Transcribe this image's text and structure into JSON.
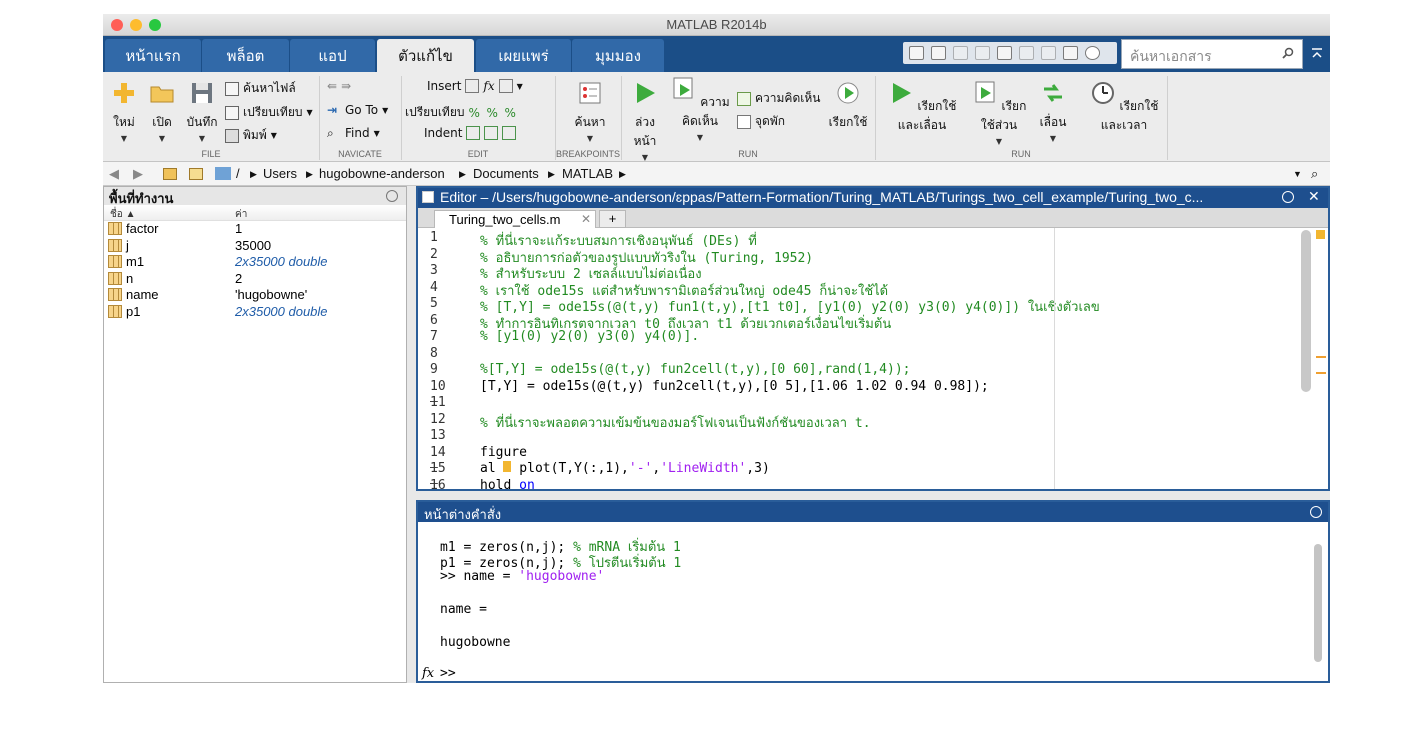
{
  "window": {
    "title": "MATLAB R2014b"
  },
  "tabs": [
    {
      "label": "หน้าแรก"
    },
    {
      "label": "พล็อต"
    },
    {
      "label": "แอป"
    },
    {
      "label": "ตัวแก้ไข",
      "active": true
    },
    {
      "label": "เผยแพร่"
    },
    {
      "label": "มุมมอง"
    }
  ],
  "search": {
    "placeholder": "ค้นหาเอกสาร"
  },
  "ribbon": {
    "file": {
      "new": "ใหม่",
      "open": "เปิด",
      "save": "บันทึก",
      "find_files": "ค้นหาไฟล์",
      "compare": "เปรียบเทียบ",
      "print": "พิมพ์",
      "section": "FILE"
    },
    "navigate": {
      "goto": "Go To",
      "find": "Find",
      "section": "NAVICATE"
    },
    "edit": {
      "insert": "Insert",
      "compare": "เปรียบเทียบ",
      "indent": "Indent",
      "section": "EDIT"
    },
    "breakpoints": {
      "search": "ค้นหา",
      "section": "BREAKPOINTS"
    },
    "run1": {
      "forward": "ล่วงหน้า",
      "comment": "ความคิดเห็น",
      "comment2": "ความคิดเห็น",
      "breakpoint": "จุดพัก",
      "run": "เรียกใช้",
      "section": "RUN"
    },
    "run2": {
      "run_advance": "เรียกใช้และเลื่อน",
      "run_section": "เรียกใช้ส่วน",
      "advance": "เลื่อน",
      "run_time": "เรียกใช้และเวลา",
      "section": "RUN"
    }
  },
  "address": {
    "path": [
      "/",
      "Users",
      "hugobowne-anderson",
      "Documents",
      "MATLAB"
    ]
  },
  "workspace": {
    "title": "พื้นที่ทำงาน",
    "col_name": "ชื่อ ▲",
    "col_value": "ค่า",
    "vars": [
      {
        "name": "factor",
        "value": "1",
        "italic": false
      },
      {
        "name": "j",
        "value": "35000",
        "italic": false
      },
      {
        "name": "m1",
        "value": "2x35000 double",
        "italic": true
      },
      {
        "name": "n",
        "value": "2",
        "italic": false
      },
      {
        "name": "name",
        "value": "'hugobowne'",
        "italic": false
      },
      {
        "name": "p1",
        "value": "2x35000 double",
        "italic": true
      }
    ]
  },
  "editor": {
    "title": "Editor – /Users/hugobowne-anderson/ɛppas/Pattern-Formation/Turing_MATLAB/Turings_two_cell_example/Turing_two_c...",
    "tab": "Turing_two_cells.m",
    "lines": [
      {
        "num": "1",
        "text": "% ที่นี่เราจะแก้ระบบสมการเชิงอนุพันธ์ (DEs) ที่"
      },
      {
        "num": "2",
        "text": "% อธิบายการก่อตัวของรูปแบบทัวริงใน (Turing, 1952)"
      },
      {
        "num": "3",
        "text": "% สำหรับระบบ 2 เซลล์แบบไม่ต่อเนื่อง"
      },
      {
        "num": "4",
        "text": "% เราใช้ ode15s แต่สำหรับพารามิเตอร์ส่วนใหญ่ ode45 ก็น่าจะใช้ได้"
      },
      {
        "num": "5",
        "text": "% [T,Y] = ode15s(@(t,y) fun1(t,y),[t1 t0], [y1(0) y2(0) y3(0) y4(0)]) ในเชิงตัวเลข"
      },
      {
        "num": "6",
        "text": "% ทำการอินทิเกรตจากเวลา t0 ถึงเวลา t1 ด้วยเวกเตอร์เงื่อนไขเริ่มต้น"
      },
      {
        "num": "7",
        "text": "% [y1(0) y2(0) y3(0) y4(0)]."
      },
      {
        "num": "8",
        "text": ""
      },
      {
        "num": "9",
        "text": "%[T,Y] = ode15s(@(t,y) fun2cell(t,y),[0 60],rand(1,4));"
      },
      {
        "num": "10 –",
        "text": "[T,Y] = ode15s(@(t,y) fun2cell(t,y),[0 5],[1.06 1.02 0.94 0.98]);"
      },
      {
        "num": "11",
        "text": ""
      },
      {
        "num": "12",
        "text": "% ที่นี่เราจะพลอตความเข้มข้นของมอร์โฟเจนเป็นฟังก์ชันของเวลา t."
      },
      {
        "num": "13",
        "text": ""
      },
      {
        "num": "14 –",
        "text": "figure"
      },
      {
        "num": "15 –",
        "text_a": "al ",
        "text_b": " plot(T,Y(:,1),",
        "str1": "'-'",
        "text_c": ",",
        "str2": "'LineWidth'",
        "text_d": ",3)"
      },
      {
        "num": "16 –",
        "text_a": "hold ",
        "kw": "on"
      }
    ]
  },
  "command": {
    "title": "หน้าต่างคำสั่ง",
    "l1_code": "m1 = zeros(n,j); ",
    "l1_cmt": "% mRNA เริ่มต้น 1",
    "l2_code": "p1 = zeros(n,j); ",
    "l2_cmt": "% โปรตีนเริ่มต้น 1",
    "l3_code": ">> name = ",
    "l3_str": "'hugobowne'",
    "l4": "name =",
    "l5": "hugobowne",
    "prompt_fx": "fx",
    "prompt": ">>"
  }
}
